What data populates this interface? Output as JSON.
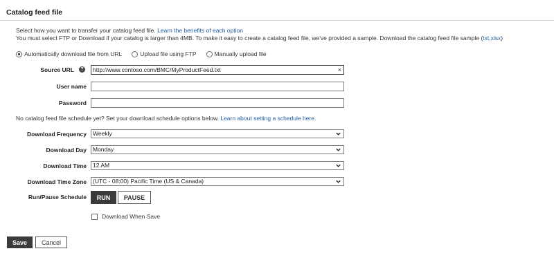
{
  "header": {
    "title": "Catalog feed file"
  },
  "intro": {
    "line1_text": "Select how you want to transfer your catalog feed file. ",
    "line1_link": "Learn the benefits of each option",
    "line2_text": "You must select FTP or Download if your catalog is larger than 4MB. To make it easy to create a catalog feed file, we've provided a sample. Download the catalog feed file sample (",
    "line2_link": "txt,xlsx",
    "line2_end": ")"
  },
  "transfer_options": [
    {
      "label": "Automatically download file from URL",
      "selected": true
    },
    {
      "label": "Upload file using FTP",
      "selected": false
    },
    {
      "label": "Manually upload file",
      "selected": false
    }
  ],
  "fields": {
    "source_url": {
      "label": "Source URL",
      "value": "http://www.contoso.com/BMC/MyProductFeed.txt",
      "clear_icon": "close-icon"
    },
    "user_name": {
      "label": "User name",
      "value": ""
    },
    "password": {
      "label": "Password",
      "value": ""
    }
  },
  "schedule_note": {
    "text": "No catalog feed file schedule yet? Set your download schedule options below. ",
    "link": "Learn about setting a schedule here."
  },
  "schedule": {
    "frequency": {
      "label": "Download Frequency",
      "value": "Weekly"
    },
    "day": {
      "label": "Download Day",
      "value": "Monday"
    },
    "time": {
      "label": "Download Time",
      "value": "12 AM"
    },
    "timezone": {
      "label": "Download Time Zone",
      "value": "(UTC - 08:00) Pacific Time (US & Canada)"
    },
    "run_pause": {
      "label": "Run/Pause Schedule",
      "run": "RUN",
      "pause": "PAUSE",
      "active": "RUN"
    }
  },
  "download_when_save": {
    "label": "Download When Save",
    "checked": false
  },
  "actions": {
    "save": "Save",
    "cancel": "Cancel"
  },
  "colors": {
    "link": "#1e5b9e",
    "dark_button": "#3b3b3b"
  }
}
